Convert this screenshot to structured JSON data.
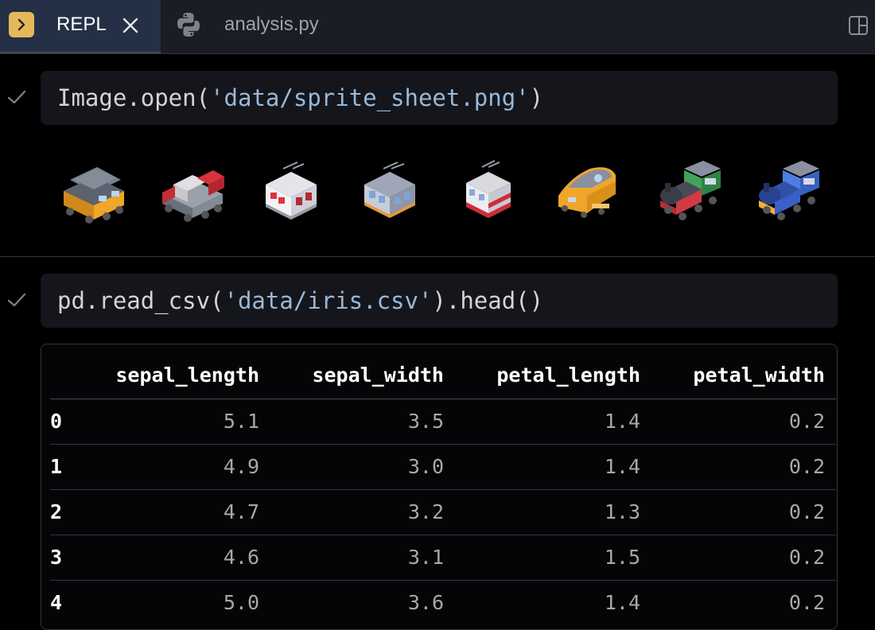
{
  "tabs": [
    {
      "label": "REPL",
      "active": true
    },
    {
      "label": "analysis.py",
      "active": false
    }
  ],
  "cells": [
    {
      "code_prefix": "Image.open(",
      "code_string": "'data/sprite_sheet.png'",
      "code_suffix": ")",
      "output": "image",
      "sprites": [
        "yellow-locomotive",
        "red-locomotive",
        "white-red-tram",
        "grey-tram",
        "red-tram",
        "orange-bullet-train",
        "green-steam-locomotive",
        "blue-steam-locomotive"
      ]
    },
    {
      "code_prefix": "pd.read_csv(",
      "code_string": "'data/iris.csv'",
      "code_suffix": ").head()",
      "output": "table"
    }
  ],
  "table": {
    "columns": [
      "sepal_length",
      "sepal_width",
      "petal_length",
      "petal_width"
    ],
    "rows": [
      {
        "index": "0",
        "values": [
          "5.1",
          "3.5",
          "1.4",
          "0.2"
        ]
      },
      {
        "index": "1",
        "values": [
          "4.9",
          "3.0",
          "1.4",
          "0.2"
        ]
      },
      {
        "index": "2",
        "values": [
          "4.7",
          "3.2",
          "1.3",
          "0.2"
        ]
      },
      {
        "index": "3",
        "values": [
          "4.6",
          "3.1",
          "1.5",
          "0.2"
        ]
      },
      {
        "index": "4",
        "values": [
          "5.0",
          "3.6",
          "1.4",
          "0.2"
        ]
      }
    ]
  },
  "colors": {
    "background": "#000000",
    "tabbar": "#1b1d24",
    "active_tab": "#243046",
    "repl_icon": "#e5b85c",
    "code_cell": "#14161c",
    "string": "#9ab8d8"
  },
  "icons": [
    "repl-icon",
    "close-icon",
    "python-icon",
    "layout-icon",
    "check-icon"
  ]
}
